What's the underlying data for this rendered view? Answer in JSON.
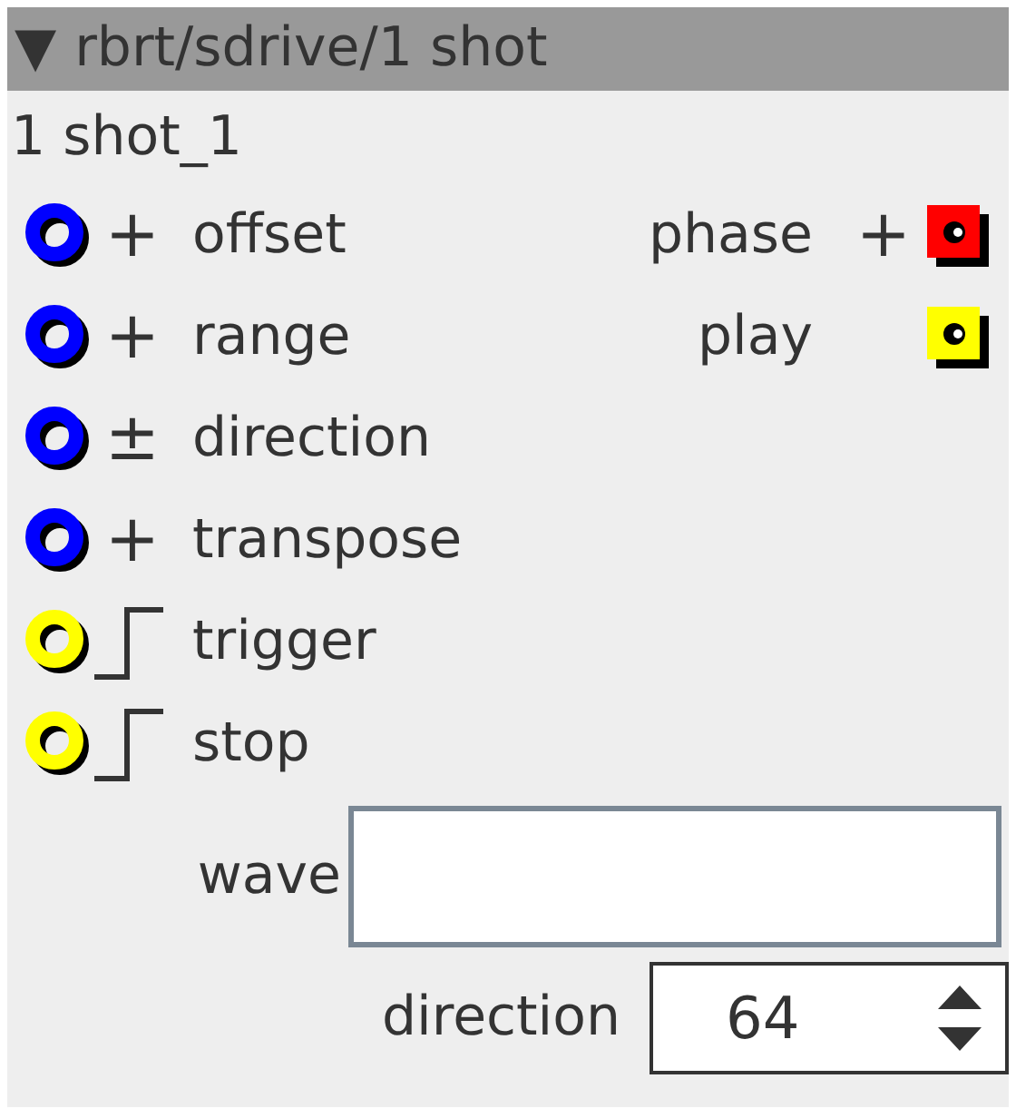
{
  "header": {
    "toggle": "▼",
    "title": "rbrt/sdrive/1 shot"
  },
  "instance": "1 shot_1",
  "inputs": [
    {
      "label": "offset",
      "kind": "sign",
      "sign": "+",
      "color": "#0000ff"
    },
    {
      "label": "range",
      "kind": "sign",
      "sign": "+",
      "color": "#0000ff"
    },
    {
      "label": "direction",
      "kind": "sign",
      "sign": "±",
      "color": "#0000ff"
    },
    {
      "label": "transpose",
      "kind": "sign",
      "sign": "+",
      "color": "#0000ff"
    },
    {
      "label": "trigger",
      "kind": "step",
      "color": "#ffff00"
    },
    {
      "label": "stop",
      "kind": "step",
      "color": "#ffff00"
    }
  ],
  "outputs": [
    {
      "label": "phase",
      "kind": "sign",
      "sign": "+",
      "color": "#ff0000"
    },
    {
      "label": "play",
      "kind": "plain",
      "color": "#ffff00"
    }
  ],
  "fields": [
    {
      "kind": "text",
      "label": "wave"
    },
    {
      "kind": "number",
      "label": "direction",
      "value": "64"
    }
  ]
}
